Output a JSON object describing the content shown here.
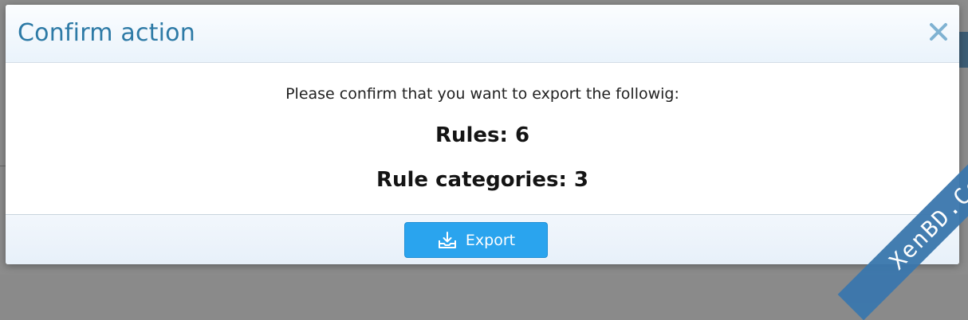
{
  "dialog": {
    "title": "Confirm action",
    "close_label": "×",
    "message": "Please confirm that you want to export the followig:",
    "stats": {
      "rules": "Rules: 6",
      "rule_categories": "Rule categories: 3"
    },
    "export_button": {
      "label": "Export",
      "icon": "download-tray-icon"
    }
  },
  "watermark": "XenBD.Com",
  "colors": {
    "title": "#2d7aa6",
    "button": "#2aa4ee",
    "close_icon": "#7fb2d2",
    "watermark": "#3a77ad"
  }
}
